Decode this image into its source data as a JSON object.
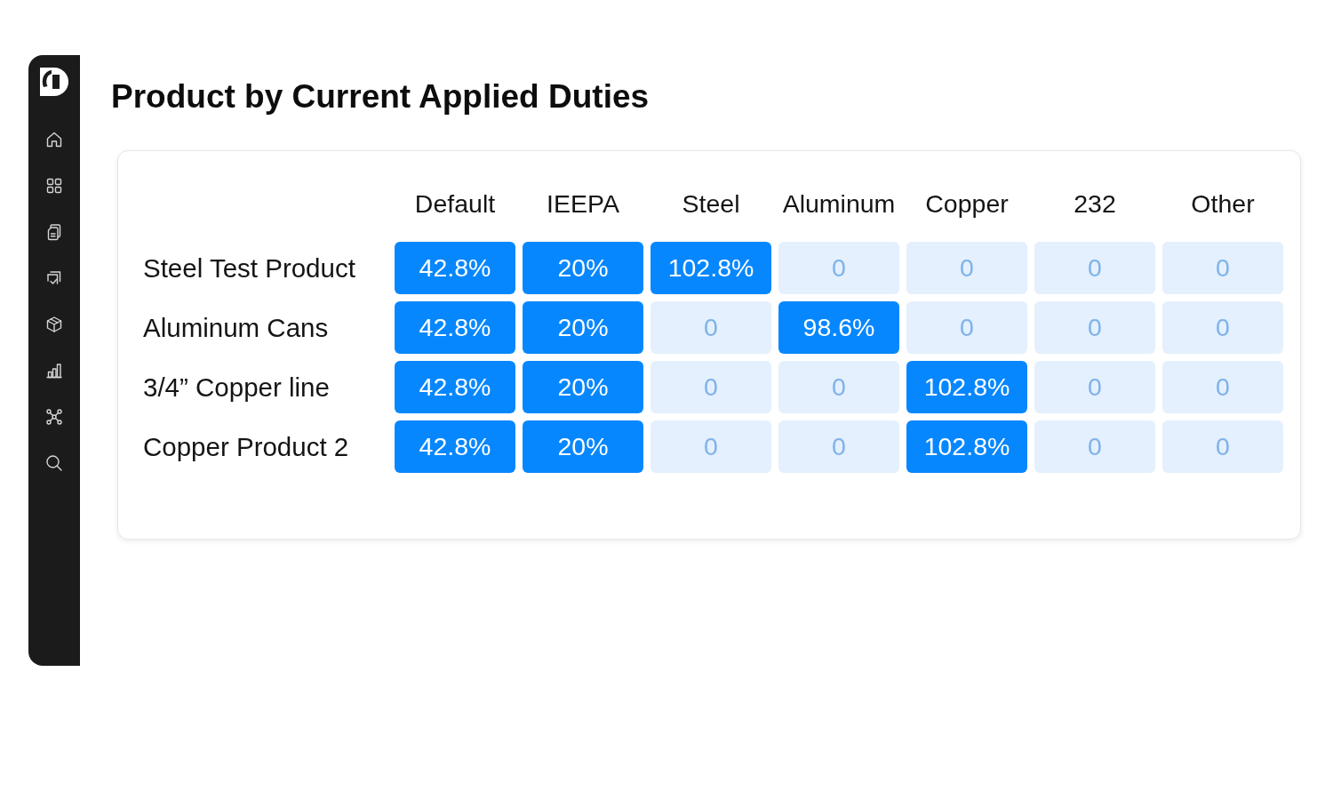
{
  "title": "Product by Current Applied Duties",
  "table": {
    "columns": [
      "Default",
      "IEEPA",
      "Steel",
      "Aluminum",
      "Copper",
      "232",
      "Other"
    ],
    "rows": [
      {
        "label": "Steel Test Product",
        "cells": [
          {
            "text": "42.8%",
            "highlighted": true
          },
          {
            "text": "20%",
            "highlighted": true
          },
          {
            "text": "102.8%",
            "highlighted": true
          },
          {
            "text": "0",
            "highlighted": false
          },
          {
            "text": "0",
            "highlighted": false
          },
          {
            "text": "0",
            "highlighted": false
          },
          {
            "text": "0",
            "highlighted": false
          }
        ]
      },
      {
        "label": "Aluminum Cans",
        "cells": [
          {
            "text": "42.8%",
            "highlighted": true
          },
          {
            "text": "20%",
            "highlighted": true
          },
          {
            "text": "0",
            "highlighted": false
          },
          {
            "text": "98.6%",
            "highlighted": true
          },
          {
            "text": "0",
            "highlighted": false
          },
          {
            "text": "0",
            "highlighted": false
          },
          {
            "text": "0",
            "highlighted": false
          }
        ]
      },
      {
        "label": "3/4” Copper line",
        "cells": [
          {
            "text": "42.8%",
            "highlighted": true
          },
          {
            "text": "20%",
            "highlighted": true
          },
          {
            "text": "0",
            "highlighted": false
          },
          {
            "text": "0",
            "highlighted": false
          },
          {
            "text": "102.8%",
            "highlighted": true
          },
          {
            "text": "0",
            "highlighted": false
          },
          {
            "text": "0",
            "highlighted": false
          }
        ]
      },
      {
        "label": "Copper Product 2",
        "cells": [
          {
            "text": "42.8%",
            "highlighted": true
          },
          {
            "text": "20%",
            "highlighted": true
          },
          {
            "text": "0",
            "highlighted": false
          },
          {
            "text": "0",
            "highlighted": false
          },
          {
            "text": "102.8%",
            "highlighted": true
          },
          {
            "text": "0",
            "highlighted": false
          },
          {
            "text": "0",
            "highlighted": false
          }
        ]
      }
    ]
  }
}
